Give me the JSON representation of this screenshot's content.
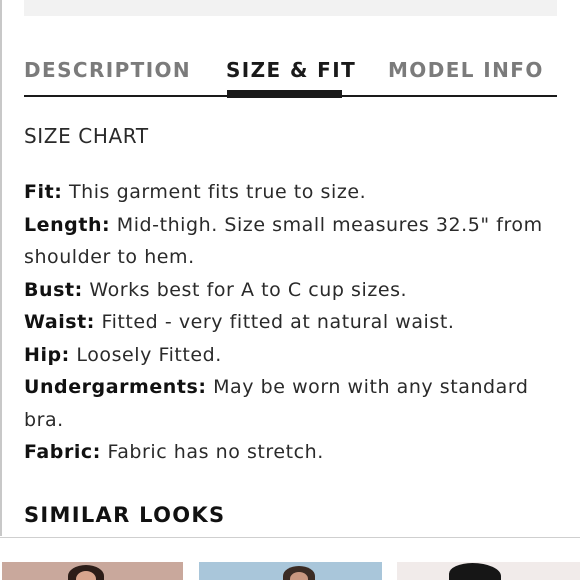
{
  "tabs": [
    {
      "label": "DESCRIPTION",
      "active": false
    },
    {
      "label": "SIZE & FIT",
      "active": true
    },
    {
      "label": "MODEL INFO",
      "active": false
    }
  ],
  "size_chart_link": "SIZE CHART",
  "details": [
    {
      "label": "Fit:",
      "value": "This garment fits true to size."
    },
    {
      "label": "Length:",
      "value": "Mid-thigh. Size small measures 32.5\" from shoulder to hem."
    },
    {
      "label": "Bust:",
      "value": "Works best for A to C cup sizes."
    },
    {
      "label": "Waist:",
      "value": "Fitted - very fitted at natural waist."
    },
    {
      "label": "Hip:",
      "value": "Loosely Fitted."
    },
    {
      "label": "Undergarments:",
      "value": "May be worn with any standard bra."
    },
    {
      "label": "Fabric:",
      "value": "Fabric has no stretch."
    }
  ],
  "similar_looks": {
    "title": "SIMILAR LOOKS"
  },
  "colors": {
    "active_tab": "#1a1a1a",
    "inactive_tab": "#7b7b7b",
    "divider": "#cfcfcf",
    "top_bar": "#f2f2f2"
  }
}
